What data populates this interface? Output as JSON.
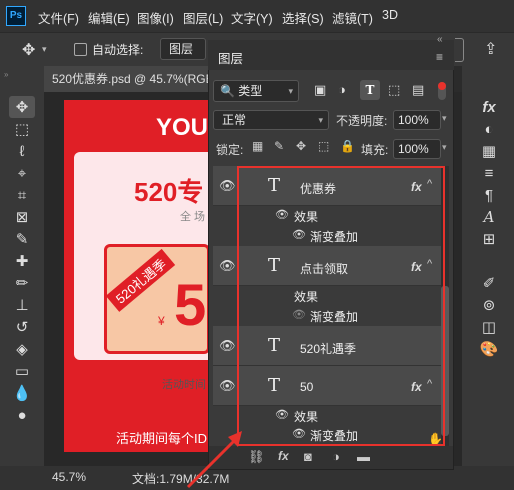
{
  "app": {
    "logo": "Ps"
  },
  "menu": [
    {
      "label": "文件(F)"
    },
    {
      "label": "编辑(E)"
    },
    {
      "label": "图像(I)"
    },
    {
      "label": "图层(L)"
    },
    {
      "label": "文字(Y)"
    },
    {
      "label": "选择(S)"
    },
    {
      "label": "滤镜(T)"
    },
    {
      "label": "3D"
    }
  ],
  "options": {
    "auto_select_label": "自动选择:",
    "auto_select_value": "图层"
  },
  "document": {
    "tab_title": "520优惠券.psd @ 45.7%(RGB"
  },
  "canvas_text": {
    "you": "YOU",
    "title": "520专",
    "sub": "全 场",
    "badge": "520礼遇季",
    "yen": "¥",
    "amount": "5",
    "time": "活动时间 2",
    "footer": "活动期间每个ID"
  },
  "status": {
    "zoom": "45.7%",
    "doc_info": "文档:1.79M/32.7M"
  },
  "layers_panel": {
    "title": "图层",
    "filter_value": "类型",
    "blend_mode": "正常",
    "opacity_label": "不透明度:",
    "opacity_value": "100%",
    "lock_label": "锁定:",
    "fill_label": "填充:",
    "fill_value": "100%",
    "effects_label": "效果",
    "fx_label": "fx",
    "layers": [
      {
        "name": "优惠券",
        "effects": [
          "渐变叠加"
        ]
      },
      {
        "name": "点击领取",
        "effects": [
          "渐变叠加"
        ]
      },
      {
        "name": "520礼遇季",
        "effects": []
      },
      {
        "name": "50",
        "effects": [
          "渐变叠加"
        ]
      }
    ]
  },
  "colors": {
    "highlight": "#e8322c",
    "coupon_red": "#e01f26"
  }
}
